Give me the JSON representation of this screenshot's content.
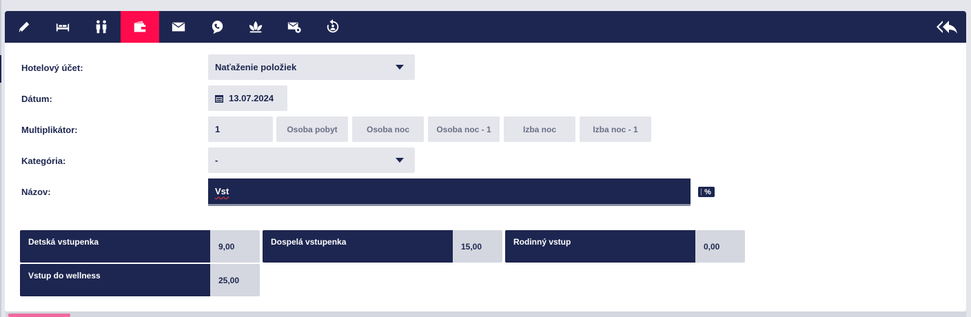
{
  "toolbar": {
    "icons": [
      "pencil-icon",
      "bed-icon",
      "people-icon",
      "wallet-icon",
      "envelope-icon",
      "phone-icon",
      "lotus-icon",
      "mail-settings-icon",
      "history-icon"
    ],
    "active_icon": "wallet-icon",
    "right_icon": "reply-all-icon"
  },
  "form": {
    "account_label": "Hotelový účet:",
    "account_value": "Naťaženie položiek",
    "date_label": "Dátum:",
    "date_value": "13.07.2024",
    "multiplier_label": "Multiplikátor:",
    "multiplier_value": "1",
    "multiplier_options": [
      "Osoba pobyt",
      "Osoba noc",
      "Osoba noc - 1",
      "Izba noc",
      "Izba noc - 1"
    ],
    "category_label": "Kategória:",
    "category_value": "-",
    "name_label": "Názov:",
    "name_value": "Vst",
    "percent_button": "%"
  },
  "items": [
    {
      "name": "Detská vstupenka",
      "price": "9,00"
    },
    {
      "name": "Dospelá vstupenka",
      "price": "15,00"
    },
    {
      "name": "Rodinný vstup",
      "price": "0,00"
    },
    {
      "name": "Vstup do wellness",
      "price": "25,00"
    }
  ],
  "colors": {
    "navy": "#1d2650",
    "accent": "#ff0a4c",
    "field_bg": "#e4e6ec"
  }
}
